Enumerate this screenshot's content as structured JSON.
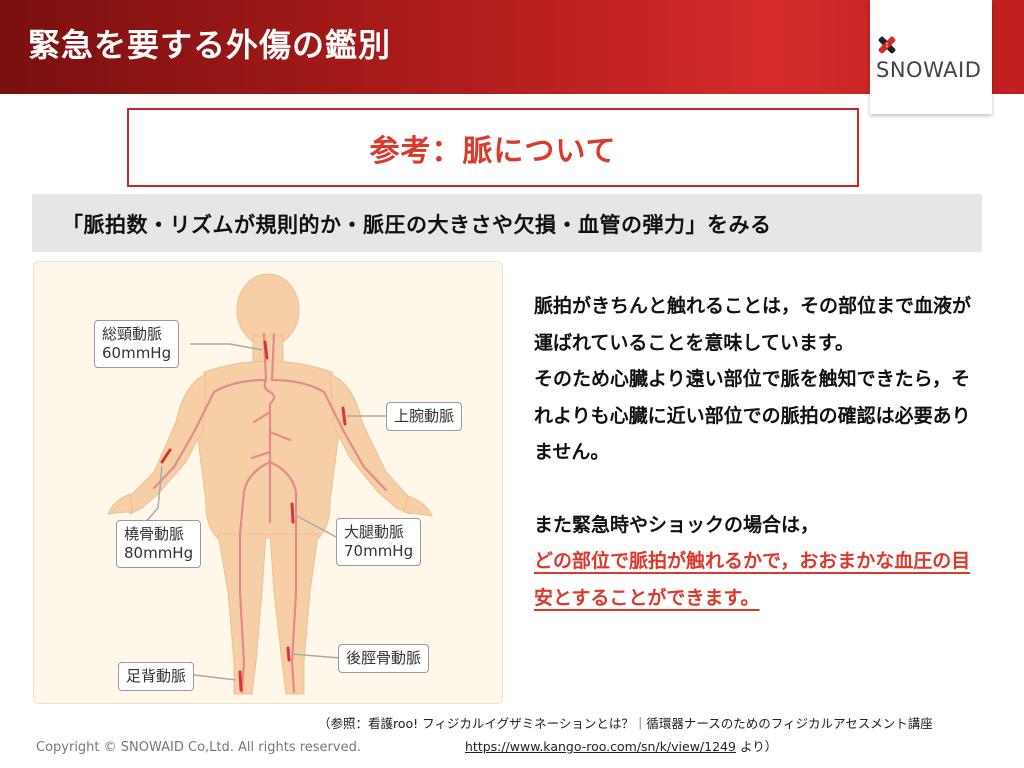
{
  "header": {
    "title": "緊急を要する外傷の鑑別"
  },
  "logo": {
    "text": "SNOWAID"
  },
  "subtitle": "参考：脈について",
  "band": "「脈拍数・リズムが規則的か・脈圧の大きさや欠損・血管の弾力」をみる",
  "figure": {
    "labels": {
      "carotid": [
        "総頸動脈",
        "60mmHg"
      ],
      "brachial": [
        "上腕動脈"
      ],
      "radial": [
        "橈骨動脈",
        "80mmHg"
      ],
      "femoral": [
        "大腿動脈",
        "70mmHg"
      ],
      "tibial": [
        "後脛骨動脈"
      ],
      "dorsalis": [
        "足背動脈"
      ]
    },
    "colors": {
      "body": "#f6cfa6",
      "artery": "#d9343a",
      "pointer": "#aaaaaa"
    }
  },
  "body": {
    "para1": "脈拍がきちんと触れることは，その部位まで血液が運ばれていることを意味しています。",
    "para2": "そのため心臓より遠い部位で脈を触知できたら，それよりも心臓に近い部位での脈拍の確認は必要ありません。",
    "para3_black": "また緊急時やショックの場合は，",
    "para3_red": "どの部位で脈拍が触れるかで，おおまかな血圧の目安とすることができます。"
  },
  "reference": {
    "line1": "（参照：看護roo!  フィジカルイグザミネーションとは？｜循環器ナースのためのフィジカルアセスメント講座",
    "url": "https://www.kango-roo.com/sn/k/view/1249",
    "suffix": "  より）"
  },
  "copyright": "Copyright © SNOWAID Co,Ltd. All rights reserved."
}
